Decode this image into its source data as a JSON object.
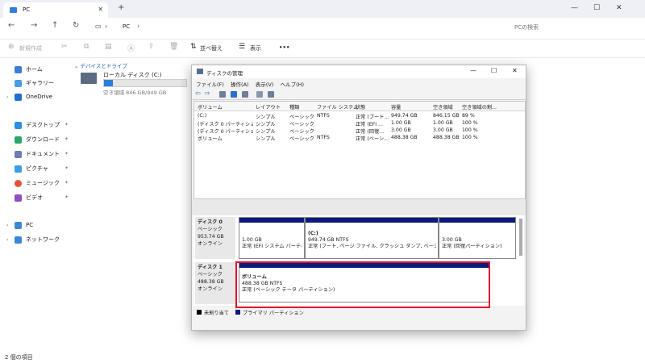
{
  "tab": {
    "title": "PC"
  },
  "address": {
    "path": "PC",
    "search_placeholder": "PCの検索"
  },
  "commands": {
    "new": "新規作成",
    "sort": "並べ替え",
    "view": "表示",
    "more": "•••"
  },
  "nav": {
    "top": [
      {
        "label": "ホーム"
      },
      {
        "label": "ギャラリー"
      },
      {
        "label": "OneDrive"
      }
    ],
    "quick": [
      {
        "label": "デスクトップ"
      },
      {
        "label": "ダウンロード"
      },
      {
        "label": "ドキュメント"
      },
      {
        "label": "ピクチャ"
      },
      {
        "label": "ミュージック"
      },
      {
        "label": "ビデオ"
      }
    ],
    "bottom": [
      {
        "label": "PC"
      },
      {
        "label": "ネットワーク"
      }
    ]
  },
  "main": {
    "group": "デバイスとドライブ",
    "drive_name": "ローカル ディスク (C:)",
    "drive_free": "空き領域 846 GB/949 GB",
    "drive_used_fraction": 0.11
  },
  "status": "2 個の項目",
  "dm": {
    "title": "ディスクの管理",
    "menu": [
      "ファイル(F)",
      "操作(A)",
      "表示(V)",
      "ヘルプ(H)"
    ],
    "columns": [
      "ボリューム",
      "レイアウト",
      "種類",
      "ファイル システム",
      "状態",
      "容量",
      "空き領域",
      "空き領域の割..."
    ],
    "rows": [
      [
        "(C:)",
        "シンプル",
        "ベーシック",
        "NTFS",
        "正常 (ブート...",
        "949.74 GB",
        "846.15 GB",
        "89 %"
      ],
      [
        "(ディスク 0 パーティション...",
        "シンプル",
        "ベーシック",
        "",
        "正常 (EFI ...",
        "1.00 GB",
        "1.00 GB",
        "100 %"
      ],
      [
        "(ディスク 0 パーティション...",
        "シンプル",
        "ベーシック",
        "",
        "正常 (回復...",
        "3.00 GB",
        "3.00 GB",
        "100 %"
      ],
      [
        "ボリューム",
        "シンプル",
        "ベーシック",
        "NTFS",
        "正常 (ベーシ...",
        "488.38 GB",
        "488.38 GB",
        "100 %"
      ]
    ],
    "disk0": {
      "name": "ディスク 0",
      "type": "ベーシック",
      "size": "953.74 GB",
      "state": "オンライン",
      "parts": [
        {
          "name": "",
          "size": "1.00 GB",
          "desc": "正常 (EFI システム パーティショ"
        },
        {
          "name": "(C:)",
          "size": "949.74 GB NTFS",
          "desc": "正常 (ブート, ページ ファイル, クラッシュ ダンプ, ベーシック データ パ"
        },
        {
          "name": "",
          "size": "3.00 GB",
          "desc": "正常 (回復パーティション)"
        }
      ]
    },
    "disk1": {
      "name": "ディスク 1",
      "type": "ベーシック",
      "size": "488.38 GB",
      "state": "オンライン",
      "part": {
        "name": "ボリューム",
        "size": "488.38 GB NTFS",
        "desc": "正常 (ベーシック データ パーティション)"
      }
    },
    "legend": {
      "unalloc": "未割り当て",
      "primary": "プライマリ パーティション"
    }
  },
  "colors": {
    "accent": "#2a7ed6",
    "partition": "#0b1a7a",
    "highlight": "#e5122b"
  }
}
